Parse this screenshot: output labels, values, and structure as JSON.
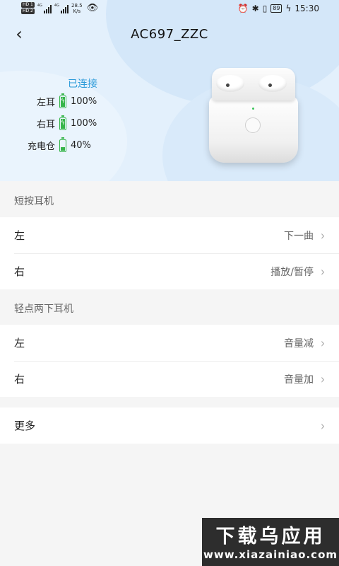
{
  "status_bar": {
    "hd1": "HD 1",
    "hd2": "HD 2",
    "net1": "4G",
    "net2": "4G",
    "speed_value": "28.5",
    "speed_unit": "K/s",
    "battery": "89",
    "time": "15:30"
  },
  "header": {
    "title": "AC697_ZZC",
    "back_glyph": "‹"
  },
  "device_status": {
    "state": "已连接",
    "items": [
      {
        "label": "左耳",
        "value": "100%",
        "level": 1.0,
        "charging": true
      },
      {
        "label": "右耳",
        "value": "100%",
        "level": 1.0,
        "charging": true
      },
      {
        "label": "充电仓",
        "value": "40%",
        "level": 0.4,
        "charging": false
      }
    ]
  },
  "sections": [
    {
      "title": "短按耳机",
      "rows": [
        {
          "key": "左",
          "value": "下一曲"
        },
        {
          "key": "右",
          "value": "播放/暂停"
        }
      ]
    },
    {
      "title": "轻点两下耳机",
      "rows": [
        {
          "key": "左",
          "value": "音量减"
        },
        {
          "key": "右",
          "value": "音量加"
        }
      ]
    }
  ],
  "more": {
    "label": "更多"
  },
  "watermark": {
    "line1": "下载乌应用",
    "line2": "www.xiazainiao.com"
  },
  "colors": {
    "accent": "#2b9ad9",
    "battery_green": "#36b54a",
    "header_bg": "#e3f0fc",
    "page_bg": "#f5f5f5"
  }
}
